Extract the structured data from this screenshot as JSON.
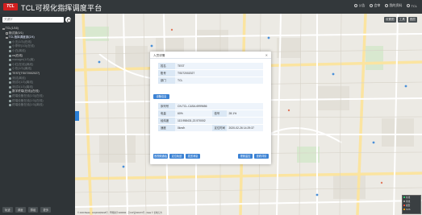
{
  "header": {
    "logo_text": "TCL",
    "title": "TCL可视化指挥调度平台",
    "actions": [
      {
        "label": "公告",
        "icon": "bell-icon"
      },
      {
        "label": "会审",
        "icon": "meeting-icon"
      },
      {
        "label": "我的资料",
        "icon": "profile-icon"
      },
      {
        "label": "TCL",
        "icon": "user-icon"
      }
    ],
    "sub_actions": [
      "设置图",
      "工具",
      "图层"
    ]
  },
  "sidebar": {
    "search_placeholder": "关键字",
    "tree": [
      {
        "label": "TCL(1/16)",
        "level": 0,
        "style": "normal"
      },
      {
        "label": "测试部(0/1)",
        "level": 1,
        "style": "normal"
      },
      {
        "label": "TCL指挥调度部(2/4)",
        "level": 1,
        "style": "hl"
      },
      {
        "label": "小王(1/3)(在线)",
        "level": 2,
        "style": "dim"
      },
      {
        "label": "小李甲(1/3)(在线)",
        "level": 2,
        "style": "dim"
      },
      {
        "label": "小白(离线)",
        "level": 2,
        "style": "dim"
      },
      {
        "label": "cs(在线)",
        "level": 2,
        "style": "normal"
      },
      {
        "label": "manager(1/3)(离)",
        "level": 2,
        "style": "dim"
      },
      {
        "label": "小红(在线)(离线)",
        "level": 2,
        "style": "dim"
      },
      {
        "label": "小东(1/3)(离线)",
        "level": 2,
        "style": "dim"
      },
      {
        "label": "TEST(TS072002027)",
        "level": 2,
        "style": "normal"
      },
      {
        "label": "测试(离线)",
        "level": 2,
        "style": "dim"
      },
      {
        "label": "测试2(1/3)(离线)",
        "level": 2,
        "style": "dim"
      },
      {
        "label": "测试3(1/3)(离线)",
        "level": 2,
        "style": "dim"
      },
      {
        "label": "数字终端(在线)(在线)",
        "level": 2,
        "style": "normal"
      },
      {
        "label": "终端设备在线(1/3)(在线)",
        "level": 2,
        "style": "dim"
      },
      {
        "label": "终端设备在线(1/3)(在线)",
        "level": 2,
        "style": "dim"
      },
      {
        "label": "终端设备在线(1/3)(离线)",
        "level": 2,
        "style": "dim"
      }
    ],
    "footer_buttons": [
      "轨迹",
      "调度",
      "群组",
      "更多"
    ]
  },
  "dialog": {
    "title": "人员详情",
    "close_glyph": "✕",
    "person": [
      {
        "label": "姓名",
        "value": "TEST"
      },
      {
        "label": "账号",
        "value": "TS072002027"
      },
      {
        "label": "部门",
        "value": "TCL"
      }
    ],
    "device_button": "设备信息",
    "device": {
      "serial_label": "序列号",
      "serial_value": "CN.TCL.C&SA.6999656",
      "power_label": "电量",
      "power_value": "60%",
      "signal_label": "信号",
      "signal_value": "28.1%",
      "coords_label": "经纬度",
      "coords_value": "113.958431,22.570002",
      "speed_label": "速度",
      "speed_value": "0km/h",
      "time_label": "定位时间",
      "time_value": "2020-02-26 14:29:37"
    },
    "left_buttons": [
      "音视频通话",
      "定位轨迹",
      "发送消息"
    ],
    "right_buttons": [
      "视频监控",
      "查看详情"
    ]
  },
  "map": {
    "attribution": "© 2020 Baidu - GS(2019)5218号 - 甲测资字1100930 - 京ICP证030173号 - Data © 长地万方"
  },
  "legend": {
    "rows": [
      {
        "label": "在线",
        "color": "#2ecc71"
      },
      {
        "label": "离线",
        "color": "#999999"
      },
      {
        "label": "报警",
        "color": "#e74c3c"
      },
      {
        "label": "SOS",
        "color": "#f39c12"
      }
    ]
  }
}
